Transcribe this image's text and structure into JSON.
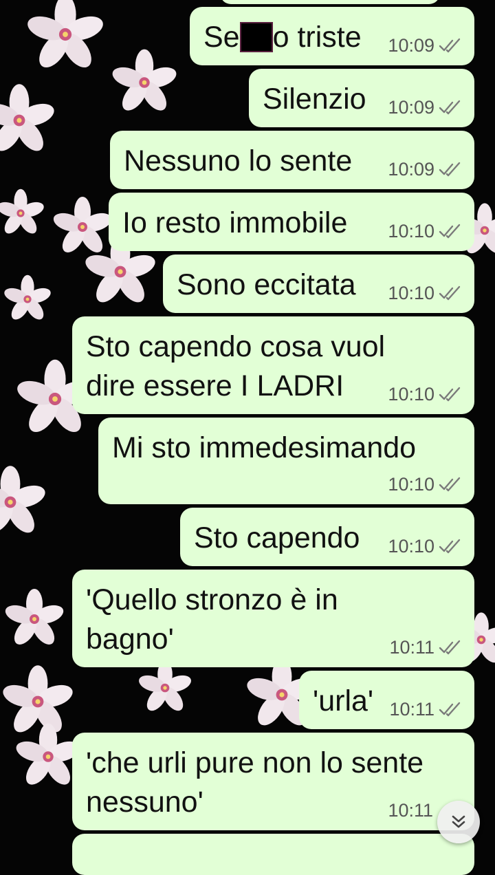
{
  "chat": {
    "messages": [
      {
        "before": "Se",
        "after": "o triste",
        "redacted": true,
        "time": "10:09",
        "status": "read"
      },
      {
        "text": "Silenzio",
        "time": "10:09",
        "status": "read"
      },
      {
        "text": "Nessuno lo sente",
        "time": "10:09",
        "status": "read"
      },
      {
        "text": "Io resto immobile",
        "time": "10:10",
        "status": "read"
      },
      {
        "text": "Sono eccitata",
        "time": "10:10",
        "status": "read"
      },
      {
        "line1": "Sto capendo cosa vuol",
        "line2": "dire essere I LADRI",
        "time": "10:10",
        "status": "read"
      },
      {
        "text": "Mi sto immedesimando",
        "time": "10:10",
        "status": "read"
      },
      {
        "text": "Sto capendo",
        "time": "10:10",
        "status": "read"
      },
      {
        "line1": "'Quello stronzo è in",
        "line2": "bagno'",
        "time": "10:11",
        "status": "read"
      },
      {
        "text": "'urla'",
        "time": "10:11",
        "status": "read"
      },
      {
        "line1": "'che urli pure non lo sente",
        "line2": "nessuno'",
        "time": "10:11",
        "status": "read"
      }
    ]
  },
  "scroll_button": {
    "icon": "double-chevron-down-icon"
  },
  "colors": {
    "outgoing_bubble": "#e2ffd6",
    "background": "#050505",
    "tick": "#7a7a7a"
  }
}
